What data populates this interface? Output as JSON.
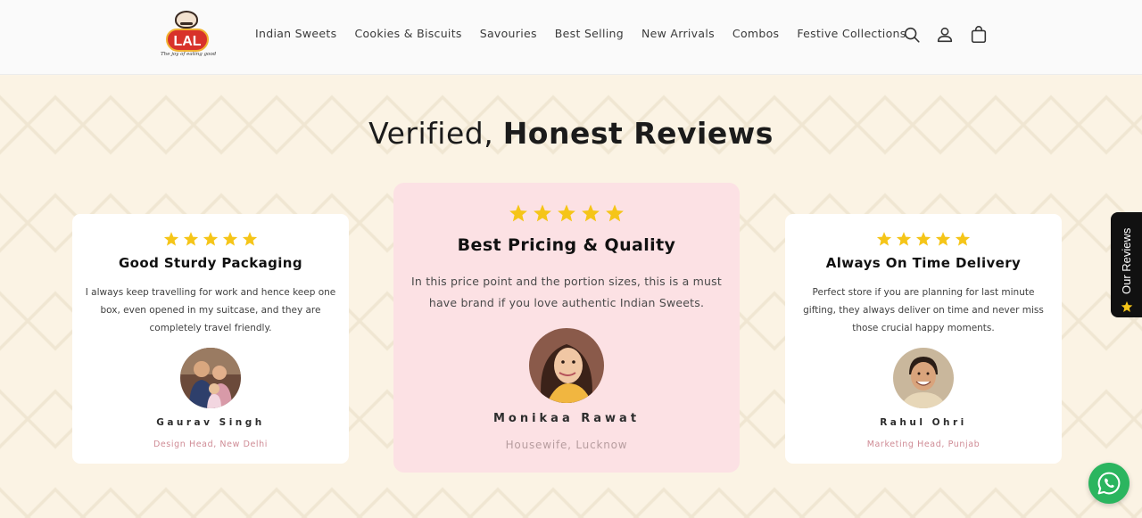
{
  "header": {
    "logo_text": "LAL",
    "logo_tagline": "The joy of eating good",
    "nav": [
      "Indian Sweets",
      "Cookies & Biscuits",
      "Savouries",
      "Best Selling",
      "New Arrivals",
      "Combos",
      "Festive Collections"
    ],
    "icons": [
      "search-icon",
      "account-icon",
      "cart-icon"
    ]
  },
  "section": {
    "heading_plain": "Verified,",
    "heading_bold": "Honest Reviews"
  },
  "reviews": [
    {
      "rating": 5,
      "title": "Good Sturdy Packaging",
      "text": "I always keep travelling for work and hence keep one box, even opened in my suitcase, and they are completely travel friendly.",
      "name": "Gaurav Singh",
      "role": "Design Head, New Delhi"
    },
    {
      "rating": 5,
      "title": "Best Pricing & Quality",
      "text": "In this price point and the portion sizes, this is a must have brand if you love authentic Indian Sweets.",
      "name": "Monikaa Rawat",
      "role": "Housewife, Lucknow"
    },
    {
      "rating": 5,
      "title": "Always On Time Delivery",
      "text": "Perfect store if you are planning for last minute gifting, they always deliver on time and never miss those crucial happy moments.",
      "name": "Rahul Ohri",
      "role": "Marketing Head, Punjab"
    }
  ],
  "side_tab": {
    "label": "Our Reviews"
  },
  "colors": {
    "star": "#f5c518",
    "center_card": "#fce1e4",
    "whatsapp": "#2bb55f",
    "brand_red": "#d8322a"
  }
}
